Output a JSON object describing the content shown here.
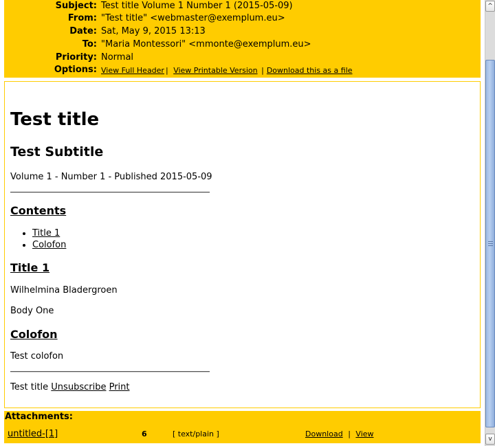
{
  "header": {
    "rows": [
      {
        "label": "Subject:",
        "value": "Test title Volume 1 Number 1 (2015-05-09)"
      },
      {
        "label": "From:",
        "value": "\"Test title\" <webmaster@exemplum.eu>"
      },
      {
        "label": "Date:",
        "value": "Sat, May 9, 2015 13:13"
      },
      {
        "label": "To:",
        "value": "\"Maria Montessori\" <mmonte@exemplum.eu>"
      },
      {
        "label": "Priority:",
        "value": "Normal"
      }
    ],
    "options_label": "Options:",
    "options": [
      {
        "label": "View Full Header"
      },
      {
        "label": "View Printable Version"
      },
      {
        "label": "Download this as a file"
      }
    ],
    "separator": "|"
  },
  "message": {
    "title": "Test title",
    "subtitle": "Test Subtitle",
    "volume_line": "Volume 1 - Number 1 - Published 2015-05-09",
    "contents_heading": "Contents",
    "toc": [
      {
        "label": "Title 1"
      },
      {
        "label": "Colofon"
      }
    ],
    "section1_heading": "Title 1",
    "section1_author": "Wilhelmina Bladergroen",
    "section1_body": "Body One",
    "colofon_heading": "Colofon",
    "colofon_body": "Test colofon",
    "footer_text": "Test title",
    "footer_links": [
      {
        "label": "Unsubscribe"
      },
      {
        "label": "Print"
      }
    ]
  },
  "attachments": {
    "heading": "Attachments:",
    "items": [
      {
        "name": "untitled-[1]",
        "size": "6",
        "type": "[ text/plain ]",
        "download_label": "Download",
        "view_label": "View"
      }
    ],
    "separator": "|"
  },
  "colors": {
    "accent": "#ffcc00"
  },
  "scrollbar": {
    "up_icon": "^",
    "down_icon": "v"
  }
}
